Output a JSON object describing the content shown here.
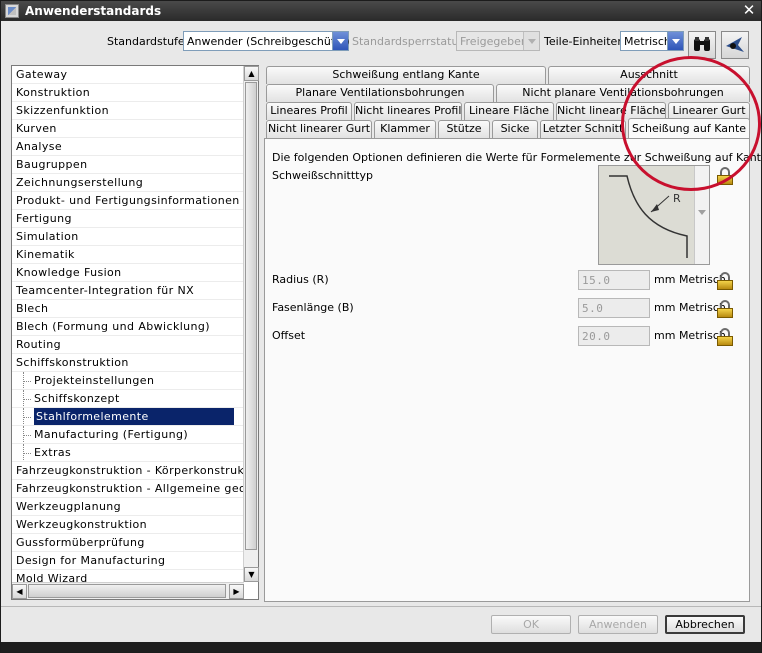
{
  "window": {
    "title": "Anwenderstandards",
    "close_glyph": "✕"
  },
  "toolbar": {
    "standardstufe_label": "Standardstufe",
    "standardstufe_value": "Anwender (Schreibgeschützt)",
    "sperrstatus_label": "Standardsperrstatus",
    "sperrstatus_value": "Freigegeben",
    "einheiten_label": "Teile-Einheiten",
    "einheiten_value": "Metrisch",
    "find_icon": "binoculars-icon",
    "tool_icon": "swoosh-icon"
  },
  "tree": {
    "items": [
      {
        "label": "Gateway",
        "child": false,
        "selected": false
      },
      {
        "label": "Konstruktion",
        "child": false,
        "selected": false
      },
      {
        "label": "Skizzenfunktion",
        "child": false,
        "selected": false
      },
      {
        "label": "Kurven",
        "child": false,
        "selected": false
      },
      {
        "label": "Analyse",
        "child": false,
        "selected": false
      },
      {
        "label": "Baugruppen",
        "child": false,
        "selected": false
      },
      {
        "label": "Zeichnungserstellung",
        "child": false,
        "selected": false
      },
      {
        "label": "Produkt- und Fertigungsinformationen",
        "child": false,
        "selected": false
      },
      {
        "label": "Fertigung",
        "child": false,
        "selected": false
      },
      {
        "label": "Simulation",
        "child": false,
        "selected": false
      },
      {
        "label": "Kinematik",
        "child": false,
        "selected": false
      },
      {
        "label": "Knowledge Fusion",
        "child": false,
        "selected": false
      },
      {
        "label": "Teamcenter-Integration für NX",
        "child": false,
        "selected": false
      },
      {
        "label": "Blech",
        "child": false,
        "selected": false
      },
      {
        "label": "Blech (Formung und Abwicklung)",
        "child": false,
        "selected": false
      },
      {
        "label": "Routing",
        "child": false,
        "selected": false
      },
      {
        "label": "Schiffskonstruktion",
        "child": false,
        "selected": false
      },
      {
        "label": "Projekteinstellungen",
        "child": true,
        "selected": false
      },
      {
        "label": "Schiffskonzept",
        "child": true,
        "selected": false
      },
      {
        "label": "Stahlformelemente",
        "child": true,
        "selected": true
      },
      {
        "label": "Manufacturing (Fertigung)",
        "child": true,
        "selected": false
      },
      {
        "label": "Extras",
        "child": true,
        "selected": false
      },
      {
        "label": "Fahrzeugkonstruktion - Körperkonstruktion",
        "child": false,
        "selected": false
      },
      {
        "label": "Fahrzeugkonstruktion - Allgemeine geom.",
        "child": false,
        "selected": false
      },
      {
        "label": "Werkzeugplanung",
        "child": false,
        "selected": false
      },
      {
        "label": "Werkzeugkonstruktion",
        "child": false,
        "selected": false
      },
      {
        "label": "Gussformüberprüfung",
        "child": false,
        "selected": false
      },
      {
        "label": "Design for Manufacturing",
        "child": false,
        "selected": false
      },
      {
        "label": "Mold Wizard",
        "child": false,
        "selected": false
      }
    ],
    "scroll_up": "▲",
    "scroll_down": "▼",
    "scroll_left": "◀",
    "scroll_right": "▶"
  },
  "tabs": {
    "row1": [
      "Schweißung entlang Kante",
      "Ausschnitt"
    ],
    "row2": [
      "Planare Ventilationsbohrungen",
      "Nicht planare Ventilationsbohrungen"
    ],
    "row3": [
      "Lineares Profil",
      "Nicht lineares Profil",
      "Lineare Fläche",
      "Nicht lineare Fläche",
      "Linearer Gurt"
    ],
    "row4": [
      "Nicht linearer Gurt",
      "Klammer",
      "Stütze",
      "Sicke",
      "Letzter Schnitt",
      "Scheißung auf Kante"
    ],
    "active": "Scheißung auf Kante"
  },
  "panel": {
    "description": "Die folgenden Optionen definieren die Werte für Formelemente zur Schweißung auf Kanten.",
    "schnitttyp_label": "Schweißschnitttyp",
    "preview_label": "R",
    "radius_label": "Radius (R)",
    "radius_value": "15.0",
    "fase_label": "Fasenlänge (B)",
    "fase_value": "5.0",
    "offset_label": "Offset",
    "offset_value": "20.0",
    "unit": "mm",
    "unit_system": "Metrisch"
  },
  "buttons": {
    "ok": "OK",
    "apply": "Anwenden",
    "cancel": "Abbrechen"
  },
  "colors": {
    "selection": "#0a246a",
    "annotation": "#c8102e",
    "lock": "#e0b020"
  }
}
